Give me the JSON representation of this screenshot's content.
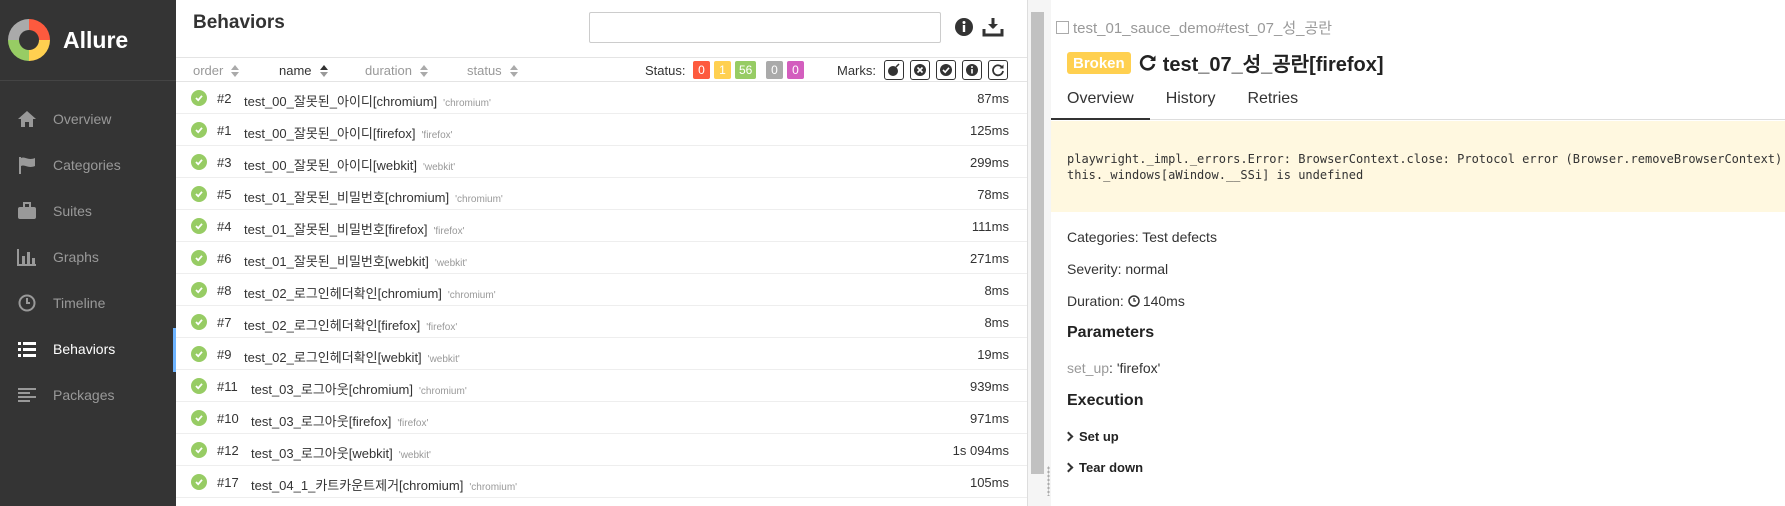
{
  "app": {
    "name": "Allure"
  },
  "sidebar": {
    "items": [
      {
        "label": "Overview",
        "icon": "home-icon",
        "active": false
      },
      {
        "label": "Categories",
        "icon": "flag-icon",
        "active": false
      },
      {
        "label": "Suites",
        "icon": "briefcase-icon",
        "active": false
      },
      {
        "label": "Graphs",
        "icon": "bar-chart-icon",
        "active": false
      },
      {
        "label": "Timeline",
        "icon": "clock-icon",
        "active": false
      },
      {
        "label": "Behaviors",
        "icon": "list-icon",
        "active": true
      },
      {
        "label": "Packages",
        "icon": "align-left-icon",
        "active": false
      }
    ]
  },
  "tree": {
    "title": "Behaviors",
    "search_value": "",
    "columns": {
      "order": "order",
      "name": "name",
      "duration": "duration",
      "status": "status"
    },
    "status_label": "Status:",
    "counts": [
      {
        "value": "0",
        "color": "#fd5a3e"
      },
      {
        "value": "1",
        "color": "#ffd050"
      },
      {
        "value": "56",
        "color": "#97cc64"
      },
      {
        "value": "0",
        "color": "#aaaaaa"
      },
      {
        "value": "0",
        "color": "#d35ebe"
      }
    ],
    "marks_label": "Marks:",
    "marks": [
      "bomb-icon",
      "times-circle-icon",
      "check-circle-icon",
      "info-circle-icon",
      "refresh-icon"
    ],
    "rows": [
      {
        "order": "#2",
        "name": "test_00_잘못된_아이디[chromium]",
        "param": "'chromium'",
        "duration": "87ms"
      },
      {
        "order": "#1",
        "name": "test_00_잘못된_아이디[firefox]",
        "param": "'firefox'",
        "duration": "125ms"
      },
      {
        "order": "#3",
        "name": "test_00_잘못된_아이디[webkit]",
        "param": "'webkit'",
        "duration": "299ms"
      },
      {
        "order": "#5",
        "name": "test_01_잘못된_비밀번호[chromium]",
        "param": "'chromium'",
        "duration": "78ms"
      },
      {
        "order": "#4",
        "name": "test_01_잘못된_비밀번호[firefox]",
        "param": "'firefox'",
        "duration": "111ms"
      },
      {
        "order": "#6",
        "name": "test_01_잘못된_비밀번호[webkit]",
        "param": "'webkit'",
        "duration": "271ms"
      },
      {
        "order": "#8",
        "name": "test_02_로그인헤더확인[chromium]",
        "param": "'chromium'",
        "duration": "8ms"
      },
      {
        "order": "#7",
        "name": "test_02_로그인헤더확인[firefox]",
        "param": "'firefox'",
        "duration": "8ms"
      },
      {
        "order": "#9",
        "name": "test_02_로그인헤더확인[webkit]",
        "param": "'webkit'",
        "duration": "19ms"
      },
      {
        "order": "#11",
        "name": "test_03_로그아웃[chromium]",
        "param": "'chromium'",
        "duration": "939ms"
      },
      {
        "order": "#10",
        "name": "test_03_로그아웃[firefox]",
        "param": "'firefox'",
        "duration": "971ms"
      },
      {
        "order": "#12",
        "name": "test_03_로그아웃[webkit]",
        "param": "'webkit'",
        "duration": "1s 094ms"
      },
      {
        "order": "#17",
        "name": "test_04_1_카트카운트제거[chromium]",
        "param": "'chromium'",
        "duration": "105ms"
      }
    ]
  },
  "detail": {
    "breadcrumb": "test_01_sauce_demo#test_07_성_공란",
    "status_badge": "Broken",
    "title": "test_07_성_공란[firefox]",
    "tabs": [
      "Overview",
      "History",
      "Retries"
    ],
    "error": "playwright._impl._errors.Error: BrowserContext.close: Protocol error (Browser.removeBrowserContext):\nthis._windows[aWindow.__SSi] is undefined",
    "categories_label": "Categories:",
    "categories_value": "Test defects",
    "severity_label": "Severity:",
    "severity_value": "normal",
    "duration_label": "Duration:",
    "duration_value": "140ms",
    "parameters_heading": "Parameters",
    "param_key": "set_up",
    "param_value": "'firefox'",
    "execution_heading": "Execution",
    "execution_items": [
      "Set up",
      "Tear down"
    ]
  }
}
